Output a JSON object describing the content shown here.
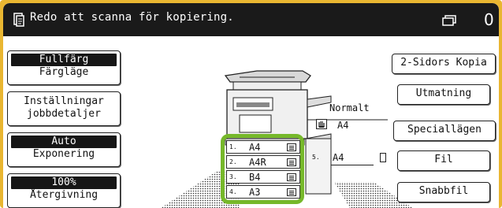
{
  "header": {
    "message": "Redo att scanna för kopiering.",
    "copy_count": "0"
  },
  "left_buttons": {
    "color_mode": {
      "value": "Fullfärg",
      "label": "Färgläge"
    },
    "job_settings": {
      "line1": "Inställningar",
      "line2": "jobbdetaljer"
    },
    "exposure": {
      "value": "Auto",
      "label": "Exponering"
    },
    "reproduction": {
      "value": "100%",
      "label": "Återgivning"
    }
  },
  "right_buttons": {
    "duplex": "2-Sidors Kopia",
    "output": "Utmatning",
    "special_modes": "Speciallägen",
    "file": "Fil",
    "quick_file": "Snabbfil"
  },
  "output_tray": {
    "mode": "Normalt",
    "paper": "A4"
  },
  "paper_trays": [
    {
      "num": "1.",
      "size": "A4",
      "selected": true
    },
    {
      "num": "2.",
      "size": "A4R",
      "selected": false
    },
    {
      "num": "3.",
      "size": "B4",
      "selected": false
    },
    {
      "num": "4.",
      "size": "A3",
      "selected": false
    }
  ],
  "bypass_tray": {
    "num": "5.",
    "size": "A4"
  },
  "colors": {
    "frame": "#e9b631",
    "header": "#1a1a1a",
    "highlight": "#76b82a"
  }
}
